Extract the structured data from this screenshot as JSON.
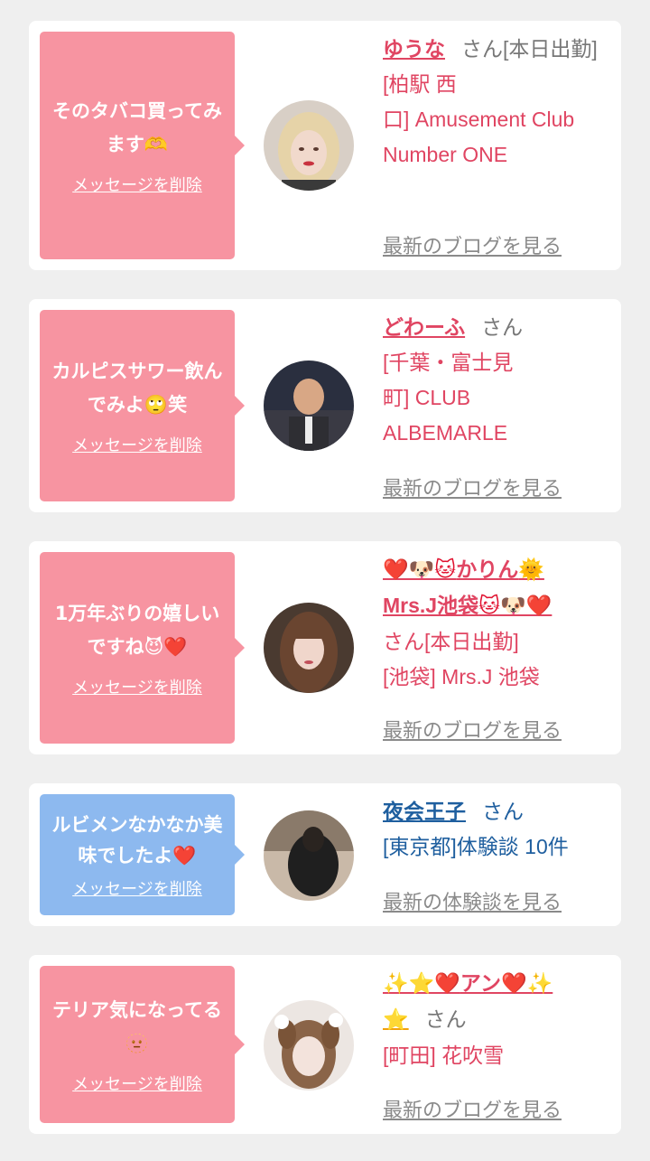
{
  "delete_label": "メッセージを削除",
  "cards": [
    {
      "message": "そのタバコ買ってみます",
      "message_emoji": "🫶",
      "name": "ゆうな",
      "honorific": "さん[本日出勤]",
      "shop_lines": [
        "[柏駅 西",
        "口] Amusement Club",
        "Number ONE"
      ],
      "link": "最新のブログを見る",
      "theme": "pink"
    },
    {
      "message": "カルピスサワー飲んでみよ",
      "message_emoji": "🙄",
      "message_tail": "笑",
      "name": "どわーふ",
      "honorific": "さん",
      "shop_lines": [
        "[千葉・富士見",
        "町] CLUB",
        "ALBEMARLE"
      ],
      "link": "最新のブログを見る",
      "theme": "pink"
    },
    {
      "message": "1万年ぶりの嬉しいですね",
      "message_emoji": "😈❤️",
      "name_prefix": "❤️🐶🐱",
      "name": "かりん",
      "name_suffix": "🌞",
      "name_line2": "Mrs.J池袋",
      "name_line2_suffix": "🐱🐶❤️",
      "honorific": "さん[本日出勤]",
      "shop_lines": [
        "[池袋] Mrs.J 池袋"
      ],
      "link": "最新のブログを見る",
      "theme": "pink"
    },
    {
      "message": "ルビメンなかなか美味でしたよ",
      "message_emoji": "❤️",
      "name": "夜会王子",
      "honorific": "さん",
      "shop_lines": [
        "[東京都]体験談 10件"
      ],
      "link": "最新の体験談を見る",
      "theme": "blue"
    },
    {
      "message": "テリア気になってる",
      "message_emoji": "🫥",
      "name_prefix": "✨⭐❤️",
      "name": "アン",
      "name_suffix": "❤️✨",
      "name_line2": "⭐",
      "honorific": "さん",
      "shop_lines": [
        "[町田] 花吹雪"
      ],
      "link": "最新のブログを見る",
      "theme": "pink"
    }
  ]
}
